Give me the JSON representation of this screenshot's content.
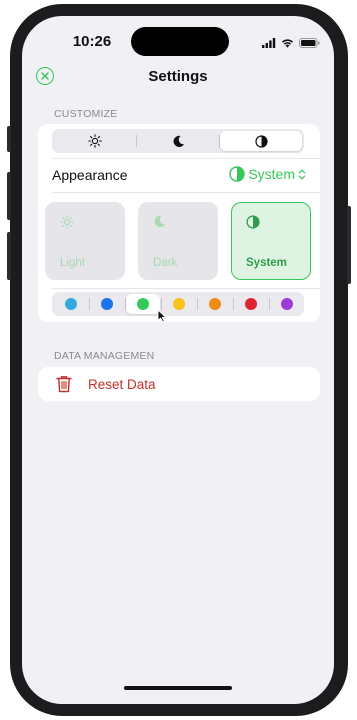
{
  "status_bar": {
    "time": "10:26"
  },
  "nav": {
    "title": "Settings"
  },
  "customize": {
    "header": "CUSTOMIZE",
    "segments": [
      "sun-icon",
      "moon-icon",
      "half-circle-icon"
    ],
    "selected_segment": 2,
    "appearance_label": "Appearance",
    "appearance_value": "System",
    "theme_cards": [
      {
        "label": "Light",
        "icon": "sun-icon"
      },
      {
        "label": "Dark",
        "icon": "moon-icon"
      },
      {
        "label": "System",
        "icon": "half-circle-icon"
      }
    ],
    "selected_theme": 2,
    "accent_colors": [
      "#34aadc",
      "#1a73e8",
      "#34c759",
      "#f5c518",
      "#ef8a17",
      "#e0242f",
      "#9b3bd6"
    ],
    "selected_accent": 2
  },
  "data_management": {
    "header": "DATA MANAGEMEN",
    "reset_label": "Reset Data"
  },
  "colors": {
    "accent": "#34c759",
    "destructive": "#c4302b",
    "background": "#f0f0f5"
  }
}
